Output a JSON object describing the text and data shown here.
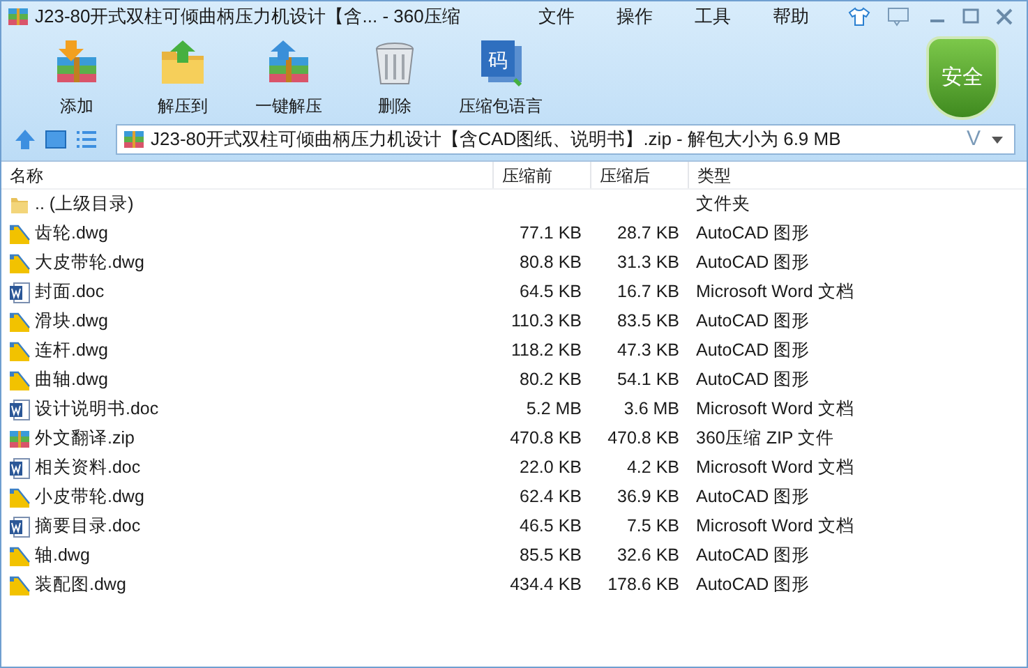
{
  "window": {
    "title": "J23-80开式双柱可倾曲柄压力机设计【含... - 360压缩"
  },
  "menu": [
    "文件",
    "操作",
    "工具",
    "帮助"
  ],
  "toolbar": [
    {
      "kind": "add",
      "label": "添加"
    },
    {
      "kind": "extract",
      "label": "解压到"
    },
    {
      "kind": "oneclick",
      "label": "一键解压"
    },
    {
      "kind": "delete",
      "label": "删除"
    },
    {
      "kind": "language",
      "label": "压缩包语言",
      "glyph": "码"
    }
  ],
  "security_badge": "安全",
  "address": {
    "value": "J23-80开式双柱可倾曲柄压力机设计【含CAD图纸、说明书】.zip - 解包大小为 6.9 MB",
    "v_mark": "V"
  },
  "table": {
    "columns": [
      "名称",
      "压缩前",
      "压缩后",
      "类型"
    ],
    "rows": [
      {
        "kind": "folder",
        "name": ".. (上级目录)",
        "type": "文件夹"
      },
      {
        "kind": "dwg",
        "name": "齿轮.dwg",
        "before": "77.1 KB",
        "after": "28.7 KB",
        "type": "AutoCAD 图形"
      },
      {
        "kind": "dwg",
        "name": "大皮带轮.dwg",
        "before": "80.8 KB",
        "after": "31.3 KB",
        "type": "AutoCAD 图形"
      },
      {
        "kind": "doc",
        "name": "封面.doc",
        "before": "64.5 KB",
        "after": "16.7 KB",
        "type": "Microsoft Word 文档"
      },
      {
        "kind": "dwg",
        "name": "滑块.dwg",
        "before": "110.3 KB",
        "after": "83.5 KB",
        "type": "AutoCAD 图形"
      },
      {
        "kind": "dwg",
        "name": "连杆.dwg",
        "before": "118.2 KB",
        "after": "47.3 KB",
        "type": "AutoCAD 图形"
      },
      {
        "kind": "dwg",
        "name": "曲轴.dwg",
        "before": "80.2 KB",
        "after": "54.1 KB",
        "type": "AutoCAD 图形"
      },
      {
        "kind": "doc",
        "name": "设计说明书.doc",
        "before": "5.2 MB",
        "after": "3.6 MB",
        "type": "Microsoft Word 文档"
      },
      {
        "kind": "zip",
        "name": "外文翻译.zip",
        "before": "470.8 KB",
        "after": "470.8 KB",
        "type": "360压缩 ZIP 文件"
      },
      {
        "kind": "doc",
        "name": "相关资料.doc",
        "before": "22.0 KB",
        "after": "4.2 KB",
        "type": "Microsoft Word 文档"
      },
      {
        "kind": "dwg",
        "name": "小皮带轮.dwg",
        "before": "62.4 KB",
        "after": "36.9 KB",
        "type": "AutoCAD 图形"
      },
      {
        "kind": "doc",
        "name": "摘要目录.doc",
        "before": "46.5 KB",
        "after": "7.5 KB",
        "type": "Microsoft Word 文档"
      },
      {
        "kind": "dwg",
        "name": "轴.dwg",
        "before": "85.5 KB",
        "after": "32.6 KB",
        "type": "AutoCAD 图形"
      },
      {
        "kind": "dwg",
        "name": "装配图.dwg",
        "before": "434.4 KB",
        "after": "178.6 KB",
        "type": "AutoCAD 图形"
      }
    ]
  }
}
